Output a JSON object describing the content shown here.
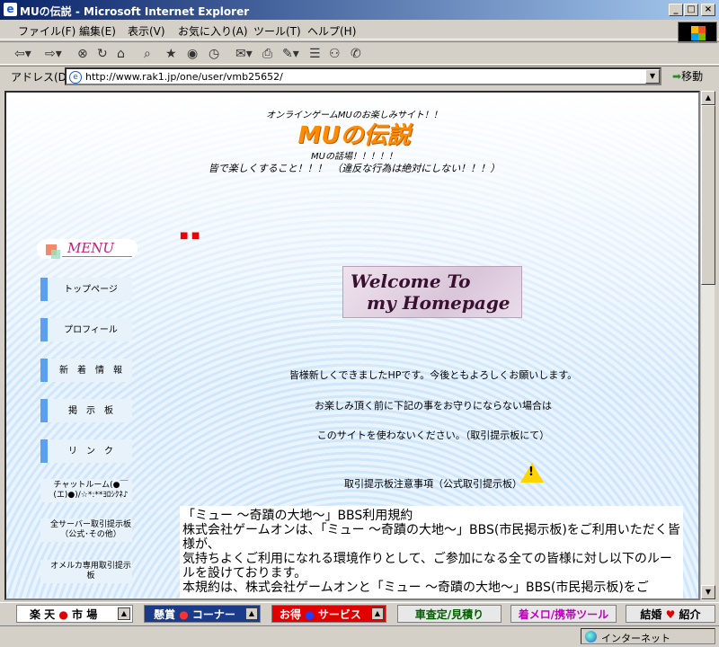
{
  "window": {
    "title": "MUの伝説 - Microsoft Internet Explorer",
    "minimize": "_",
    "maximize": "□",
    "close": "×"
  },
  "menubar": [
    "ファイル(F)",
    "編集(E)",
    "表示(V)",
    "お気に入り(A)",
    "ツール(T)",
    "ヘルプ(H)"
  ],
  "address": {
    "label": "アドレス(D)",
    "url": "http://www.rak1.jp/one/user/vmb25652/",
    "go_label": "移動"
  },
  "page": {
    "tagline": "オンラインゲームMUのお楽しみサイト！！",
    "title": "MUの伝説",
    "subtitle1": "MUの話場！！！！！",
    "subtitle2": "皆で楽しくすること！！！　（違反な行為は絶対にしない！！！）",
    "dots": "■ ■",
    "menu_logo": "MENU",
    "nav": [
      "トップページ",
      "プロフィール",
      "新　着　情　報",
      "掲　示　板",
      "リ　ン　ク",
      "チャットルーム(●￣(エ)●)/☆*:**ﾖﾛｼｸﾈ♪",
      "全サーバー取引提示板（公式･その他）",
      "オメルカ専用取引提示板"
    ],
    "welcome_line1": "Welcome To",
    "welcome_line2": "my Homepage",
    "msg1": "皆様新しくできましたHPです。今後ともよろしくお願いします。",
    "msg2": "お楽しみ頂く前に下記の事をお守りにならない場合は",
    "msg3": "このサイトを使わないください。（取引提示板にて）",
    "msg4": "取引提示板注意事項（公式取引提示板）",
    "rules": [
      "「ミュー ～奇蹟の大地～」BBS利用規約",
      "株式会社ゲームオンは、「ミュー ～奇蹟の大地～」BBS(市民掲示板)をご利用いただく皆様が、",
      "気持ちよくご利用になれる環境作りとして、ご参加になる全ての皆様に対し以下のルールを設けております。",
      "本規約は、株式会社ゲームオンと「ミュー ～奇蹟の大地～」BBS(市民掲示板)をご"
    ]
  },
  "bottom_bar": [
    {
      "label": "楽 天 ● 市 場",
      "color": "#c00000"
    },
    {
      "label": "懸賞 ● コーナー",
      "color": "#ffd000"
    },
    {
      "label": "お得 ● サービス",
      "color": "#ffffff"
    },
    {
      "label": "車査定/見積り",
      "color": "#006000"
    },
    {
      "label": "着メロ/携帯ツール",
      "color": "#c000c0"
    },
    {
      "label": "結婚 ♥ 紹介",
      "color": "#000000"
    }
  ],
  "status": {
    "zone": "インターネット"
  }
}
